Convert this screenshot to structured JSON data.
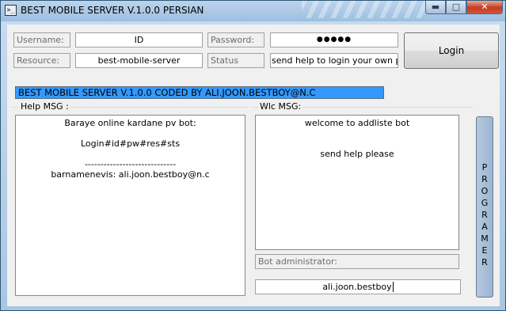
{
  "window": {
    "title": "BEST MOBILE SERVER V.1.0.0 PERSIAN",
    "icon": "console-icon",
    "controls": {
      "minimize": "minimize-icon",
      "maximize": "maximize-icon",
      "close": "close-icon"
    },
    "minimize_glyph": "▬",
    "maximize_glyph": "□",
    "close_glyph": "✕"
  },
  "login": {
    "username_label": "Username:",
    "username_value": "ID",
    "password_label": "Password:",
    "password_value": "●●●●●",
    "resource_label": "Resource:",
    "resource_value": "best-mobile-server",
    "status_label": "Status",
    "status_value": "send help to login your own pv bo",
    "login_button": "Login"
  },
  "banner": "BEST MOBILE SERVER V.1.0.0 CODED BY ALI.JOON.BESTBOY@N.C",
  "help": {
    "caption": "Help MSG :",
    "lines": [
      "Baraye online kardane pv bot:",
      "",
      "Login#id#pw#res#sts",
      "",
      "-----------------------------",
      "barnamenevis: ali.joon.bestboy@n.c"
    ]
  },
  "welcome": {
    "caption": "Wlc MSG:",
    "lines": [
      "welcome to addliste bot",
      "",
      "",
      "send help please"
    ]
  },
  "admin": {
    "label": "Bot administrator:",
    "value": "ali.joon.bestboy"
  },
  "programmer_button": [
    "P",
    "R",
    "O",
    "G",
    "R",
    "A",
    "M",
    "E",
    "R"
  ],
  "colors": {
    "banner": "#3399ff",
    "close_button": "#c43b1f",
    "title_bar": "#a9c6e2"
  }
}
